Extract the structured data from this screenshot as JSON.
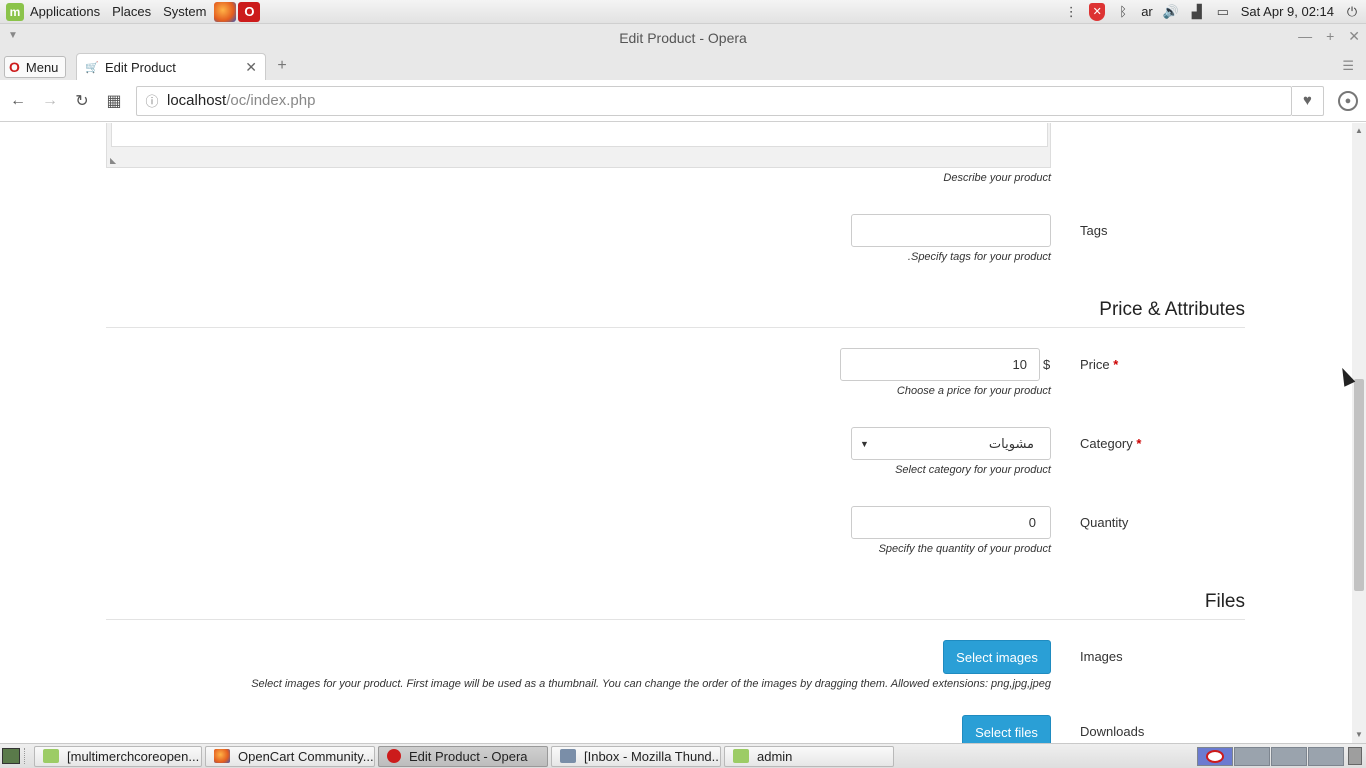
{
  "system_panel": {
    "menus": [
      "Applications",
      "Places",
      "System"
    ],
    "keyboard_layout": "ar",
    "clock": "Sat Apr 9, 02:14"
  },
  "window": {
    "title": "Edit Product - Opera"
  },
  "browser": {
    "menu_label": "Menu",
    "tab_title": "Edit Product",
    "url_host": "localhost",
    "url_path": "/oc/index.php"
  },
  "form": {
    "description_help": "Describe your product",
    "tags": {
      "label": "Tags",
      "value": "",
      "help": ".Specify tags for your product"
    },
    "price_section_title": "Price & Attributes",
    "price": {
      "label": "Price",
      "required_mark": "*",
      "value": "10",
      "currency": "$",
      "help": "Choose a price for your product"
    },
    "category": {
      "label": "Category",
      "required_mark": "*",
      "value": "مشويات",
      "help": "Select category for your product"
    },
    "quantity": {
      "label": "Quantity",
      "value": "0",
      "help": "Specify the quantity of your product"
    },
    "files_section_title": "Files",
    "images": {
      "label": "Images",
      "button": "Select images",
      "help": "Select images for your product. First image will be used as a thumbnail. You can change the order of the images by dragging them. Allowed extensions: png,jpg,jpeg"
    },
    "downloads": {
      "label": "Downloads",
      "button": "Select files"
    }
  },
  "taskbar": {
    "tasks": [
      {
        "label": "[multimerchcoreopen...",
        "icon": "folder-icon"
      },
      {
        "label": "OpenCart Community...",
        "icon": "firefox-icon"
      },
      {
        "label": "Edit Product - Opera",
        "icon": "opera-icon"
      },
      {
        "label": "[Inbox - Mozilla Thund...",
        "icon": "mail-icon"
      },
      {
        "label": "admin",
        "icon": "folder-icon"
      }
    ]
  }
}
